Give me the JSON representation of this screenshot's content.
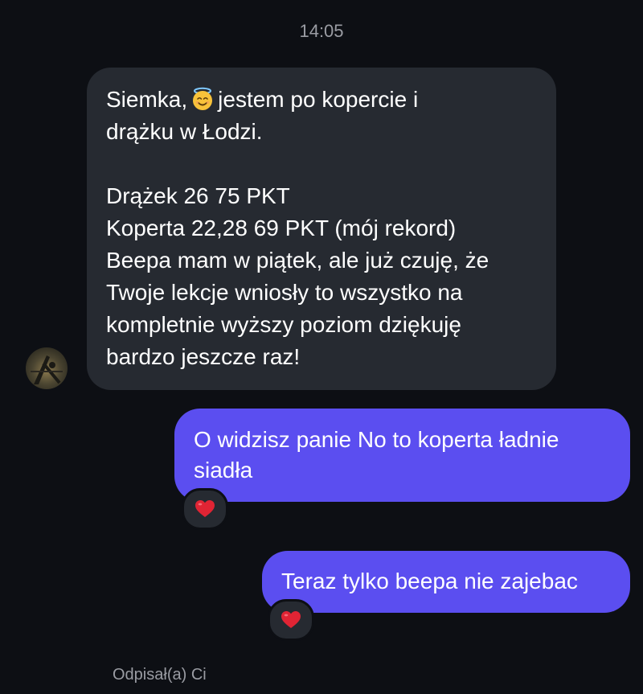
{
  "conversation": {
    "timestamp": "14:05",
    "incoming_message": {
      "lines": [
        {
          "before_emoji": "Siemka,",
          "emoji": "smiling-face-with-halo",
          "after_emoji": "jestem po kopercie i"
        },
        "drążku w Łodzi.",
        "",
        "Drążek 26 75 PKT",
        "Koperta 22,28 69 PKT (mój rekord)",
        "Beepa mam w piątek, ale już czuję, że",
        "Twoje lekcje wniosły to wszystko na",
        "kompletnie wyższy poziom dziękuję",
        "bardzo jeszcze raz!"
      ]
    },
    "outgoing_messages": [
      {
        "lines": [
          "O widzisz panie No to koperta ładnie",
          "siadła"
        ],
        "reaction": "red-heart"
      },
      {
        "lines": [
          "Teraz tylko beepa nie zajebac"
        ],
        "reaction": "red-heart"
      }
    ],
    "reply_status": "Odpisał(a) Ci"
  },
  "colors": {
    "background": "#0d0f14",
    "incoming_bubble": "#262a31",
    "outgoing_bubble": "#5b4ef0",
    "meta_text": "#9a9ca3"
  }
}
